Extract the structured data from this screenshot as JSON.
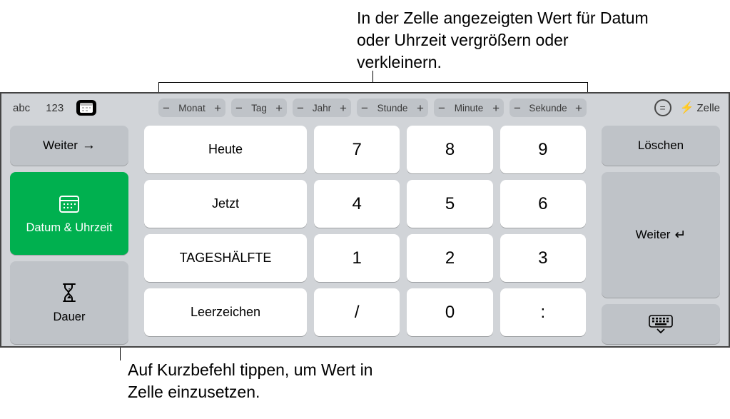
{
  "annotations": {
    "top": "In der Zelle angezeigten Wert für Datum oder Uhrzeit vergrößern oder verkleinern.",
    "bottom": "Auf Kurzbefehl tippen, um Wert in Zelle einzusetzen."
  },
  "toolbar": {
    "modes": {
      "abc": "abc",
      "num": "123"
    },
    "steppers": [
      "Monat",
      "Tag",
      "Jahr",
      "Stunde",
      "Minute",
      "Sekunde"
    ],
    "zelle": "Zelle"
  },
  "left": {
    "weiter": "Weiter",
    "datum_uhrzeit": "Datum & Uhrzeit",
    "dauer": "Dauer"
  },
  "right": {
    "loeschen": "Löschen",
    "weiter": "Weiter"
  },
  "shortcuts": [
    "Heute",
    "Jetzt",
    "TAGESHÄLFTE",
    "Leerzeichen"
  ],
  "numpad": [
    [
      "7",
      "8",
      "9"
    ],
    [
      "4",
      "5",
      "6"
    ],
    [
      "1",
      "2",
      "3"
    ],
    [
      "/",
      "0",
      ":"
    ]
  ]
}
